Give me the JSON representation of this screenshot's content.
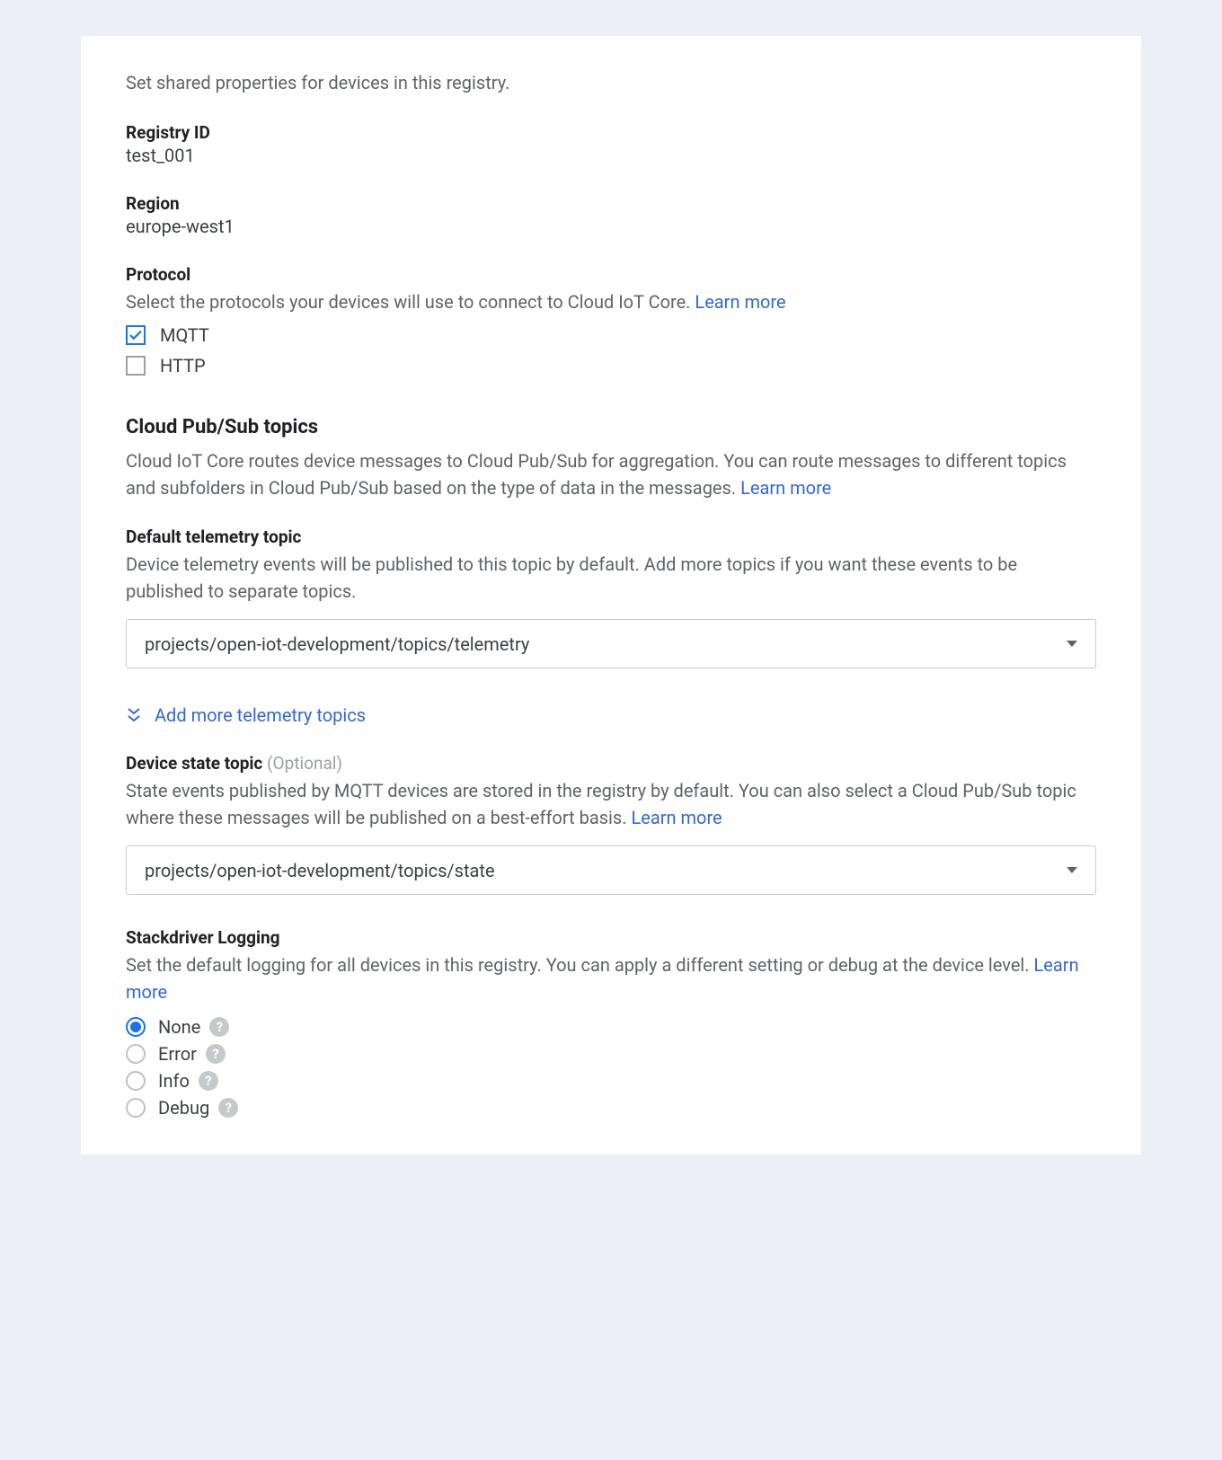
{
  "intro": "Set shared properties for devices in this registry.",
  "registry": {
    "label": "Registry ID",
    "value": "test_001"
  },
  "region": {
    "label": "Region",
    "value": "europe-west1"
  },
  "protocol": {
    "label": "Protocol",
    "description": "Select the protocols your devices will use to connect to Cloud IoT Core. ",
    "learn_more": "Learn more",
    "options": [
      {
        "label": "MQTT",
        "checked": true
      },
      {
        "label": "HTTP",
        "checked": false
      }
    ]
  },
  "pubsub": {
    "heading": "Cloud Pub/Sub topics",
    "description": "Cloud IoT Core routes device messages to Cloud Pub/Sub for aggregation. You can route messages to different topics and subfolders in Cloud Pub/Sub based on the type of data in the messages. ",
    "learn_more": "Learn more"
  },
  "telemetry": {
    "label": "Default telemetry topic",
    "description": "Device telemetry events will be published to this topic by default. Add more topics if you want these events to be published to separate topics.",
    "value": "projects/open-iot-development/topics/telemetry",
    "add_more": "Add more telemetry topics"
  },
  "state_topic": {
    "label": "Device state topic ",
    "optional": "(Optional)",
    "description": "State events published by MQTT devices are stored in the registry by default. You can also select a Cloud Pub/Sub topic where these messages will be published on a best-effort basis. ",
    "learn_more": "Learn more",
    "value": "projects/open-iot-development/topics/state"
  },
  "logging": {
    "label": "Stackdriver Logging",
    "description": "Set the default logging for all devices in this registry. You can apply a different setting or debug at the device level. ",
    "learn_more": "Learn more",
    "options": [
      {
        "label": "None",
        "selected": true
      },
      {
        "label": "Error",
        "selected": false
      },
      {
        "label": "Info",
        "selected": false
      },
      {
        "label": "Debug",
        "selected": false
      }
    ]
  }
}
